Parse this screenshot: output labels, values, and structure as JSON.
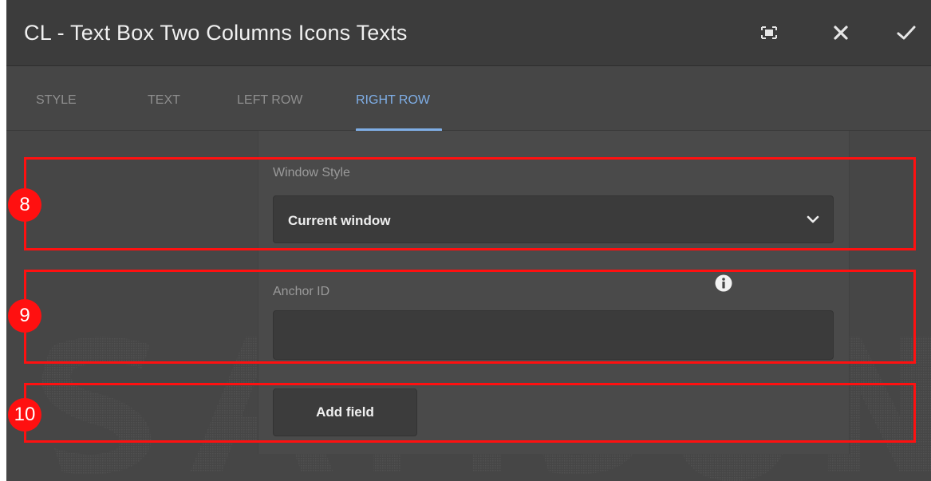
{
  "dialog": {
    "title": "CL - Text Box Two Columns Icons Texts"
  },
  "header_actions": {
    "fullscreen_icon": "fullscreen-icon",
    "close_icon": "close-icon",
    "done_icon": "checkmark-icon"
  },
  "tabs": [
    {
      "label": "STYLE",
      "active": false
    },
    {
      "label": "TEXT",
      "active": false
    },
    {
      "label": "LEFT ROW",
      "active": false
    },
    {
      "label": "RIGHT ROW",
      "active": true
    }
  ],
  "fields": {
    "window_style": {
      "label": "Window Style",
      "value": "Current window"
    },
    "anchor_id": {
      "label": "Anchor ID",
      "value": "",
      "info_icon": "info-icon"
    },
    "add_field": {
      "label": "Add field"
    }
  },
  "annotations": [
    {
      "number": "8"
    },
    {
      "number": "9"
    },
    {
      "number": "10"
    }
  ],
  "colors": {
    "accent": "#7faee6",
    "annotation": "#ff1010",
    "header_bg": "#3c3c3c",
    "body_bg": "#464646",
    "input_bg": "#3b3b3b"
  }
}
